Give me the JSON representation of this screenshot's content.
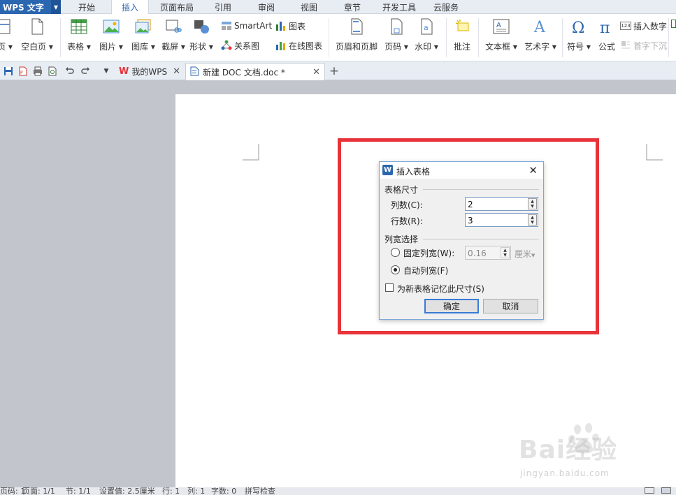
{
  "app": {
    "name": "WPS 文字"
  },
  "menu_tabs": [
    "开始",
    "插入",
    "页面布局",
    "引用",
    "审阅",
    "视图",
    "章节",
    "开发工具",
    "云服务"
  ],
  "ribbon": {
    "page_partial": "页",
    "blank_page": "空白页",
    "table": "表格",
    "picture": "图片",
    "gallery": "图库",
    "screenshot": "截屏",
    "shape": "形状",
    "smartart": "SmartArt",
    "relation_chart": "关系图",
    "chart": "图表",
    "online_chart": "在线图表",
    "header_footer": "页眉和页脚",
    "page_number": "页码",
    "watermark": "水印",
    "comment": "批注",
    "textbox": "文本框",
    "wordart": "艺术字",
    "symbol": "符号",
    "formula": "公式",
    "insert_number": "插入数字",
    "drop_cap": "首字下沉",
    "insert_number_badge": "123"
  },
  "doc_tabs": [
    {
      "label": "我的WPS"
    },
    {
      "label": "新建 DOC 文档.doc *"
    }
  ],
  "dialog": {
    "title": "插入表格",
    "section_size": "表格尺寸",
    "columns_label": "列数(C):",
    "columns_value": "2",
    "rows_label": "行数(R):",
    "rows_value": "3",
    "section_width": "列宽选择",
    "fixed_width_label": "固定列宽(W):",
    "fixed_width_value": "0.16",
    "unit": "厘米",
    "auto_width_label": "自动列宽(F)",
    "remember_label": "为新表格记忆此尺寸(S)",
    "ok": "确定",
    "cancel": "取消",
    "auto_width_selected": true,
    "remember_checked": false
  },
  "statusbar": {
    "items": [
      "页码: 1",
      "页面: 1/1",
      "节: 1/1",
      "设置值: 2.5厘米",
      "行: 1",
      "列: 1",
      "字数: 0",
      "拼写检查"
    ]
  },
  "watermark": {
    "big": "Bai经验",
    "small": "jingyan.baidu.com"
  },
  "colors": {
    "accent": "#2b66b0",
    "highlight": "#e8333a",
    "workspace": "#c2c5cc"
  }
}
